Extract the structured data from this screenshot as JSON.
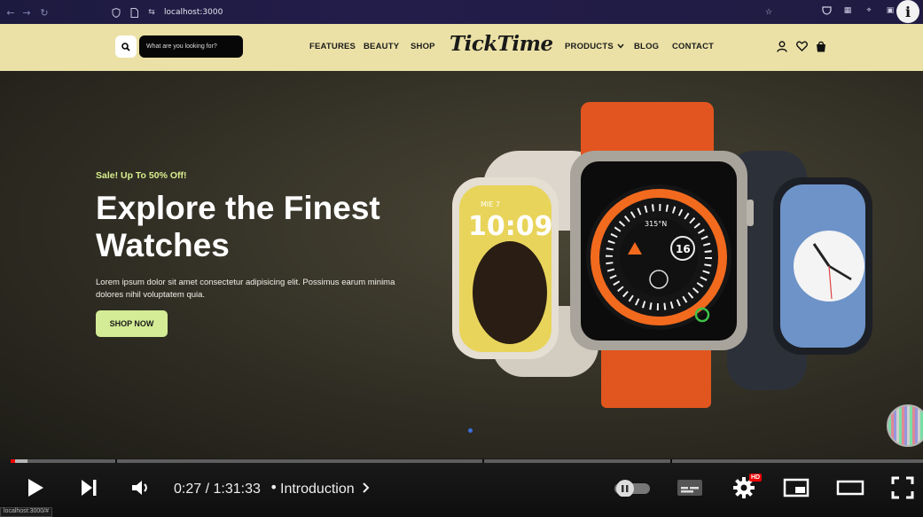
{
  "browser": {
    "url": "localhost:3000",
    "info_glyph": "i"
  },
  "site": {
    "search_placeholder": "What are you looking for?",
    "nav_left": [
      "FEATURES",
      "BEAUTY",
      "SHOP"
    ],
    "logo": "TickTime",
    "nav_right": [
      "PRODUCTS",
      "BLOG",
      "CONTACT"
    ]
  },
  "hero": {
    "sale_text": "Sale! Up To 50% Off!",
    "headline": "Explore the Finest Watches",
    "paragraph": "Lorem ipsum dolor sit amet consectetur adipisicing elit. Possimus earum minima dolores nihil voluptatem quia.",
    "cta_label": "SHOP NOW",
    "watch_left_time": "10:09",
    "watch_left_date": "MIE 7",
    "watch_center_heading": "315°N",
    "watch_center_date": "16"
  },
  "player": {
    "current_time": "0:27",
    "duration": "1:31:33",
    "time_display": "0:27 / 1:31:33",
    "separator": "•",
    "chapter": "Introduction",
    "hd_badge": "HD",
    "progress_fraction": 0.005,
    "buffered_fraction": 0.018
  },
  "status_bar": {
    "url": "localhost:3000/#"
  },
  "colors": {
    "header_bg": "#ebe1a6",
    "sale_text": "#d9ef8e",
    "cta_bg": "#d3ec95",
    "progress_red": "#ff0000",
    "carousel_dot": "#3d6fd8"
  }
}
